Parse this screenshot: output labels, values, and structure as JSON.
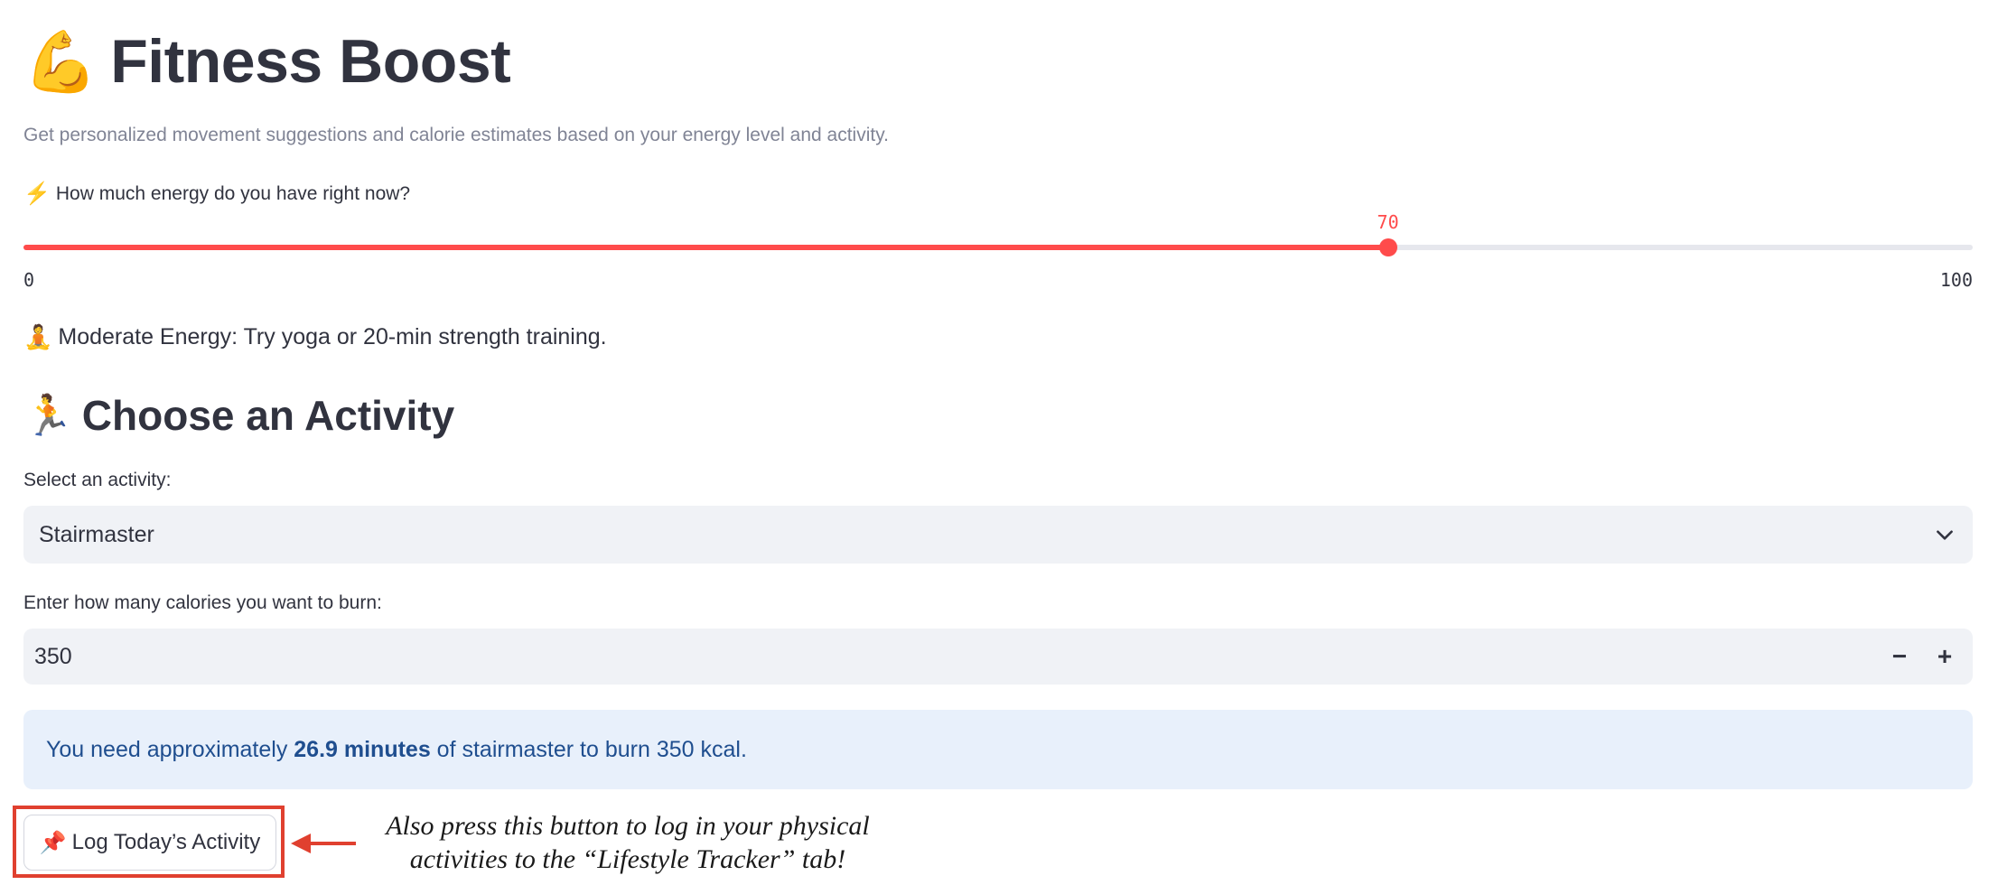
{
  "header": {
    "icon": "flexed-biceps-icon",
    "icon_glyph": "💪",
    "title": "Fitness Boost",
    "subtitle": "Get personalized movement suggestions and calorie estimates based on your energy level and activity."
  },
  "energy": {
    "icon": "lightning-bolt-icon",
    "icon_glyph": "⚡",
    "label": "How much energy do you have right now?",
    "value": 70,
    "value_label": "70",
    "min": 0,
    "max": 100,
    "min_label": "0",
    "max_label": "100",
    "accent_color": "#ff4b4b"
  },
  "suggestion": {
    "icon": "meditation-icon",
    "icon_glyph": "🧘",
    "text": "Moderate Energy: Try yoga or 20-min strength training."
  },
  "activity_section": {
    "icon": "running-person-icon",
    "icon_glyph": "🏃",
    "heading": "Choose an Activity",
    "select_label": "Select an activity:",
    "selected_activity": "Stairmaster",
    "calories_label": "Enter how many calories you want to burn:",
    "calories_value": "350",
    "decrement_glyph": "−",
    "increment_glyph": "+"
  },
  "result": {
    "prefix": "You need approximately ",
    "minutes": "26.9 minutes",
    "suffix": " of stairmaster to burn 350 kcal."
  },
  "log_button": {
    "icon": "pushpin-icon",
    "icon_glyph": "📌",
    "label": "Log Today’s Activity"
  },
  "annotation": {
    "line1": "Also press this button to log in your physical",
    "line2": "activities to the “Lifestyle Tracker” tab!",
    "color": "#e0402f"
  }
}
